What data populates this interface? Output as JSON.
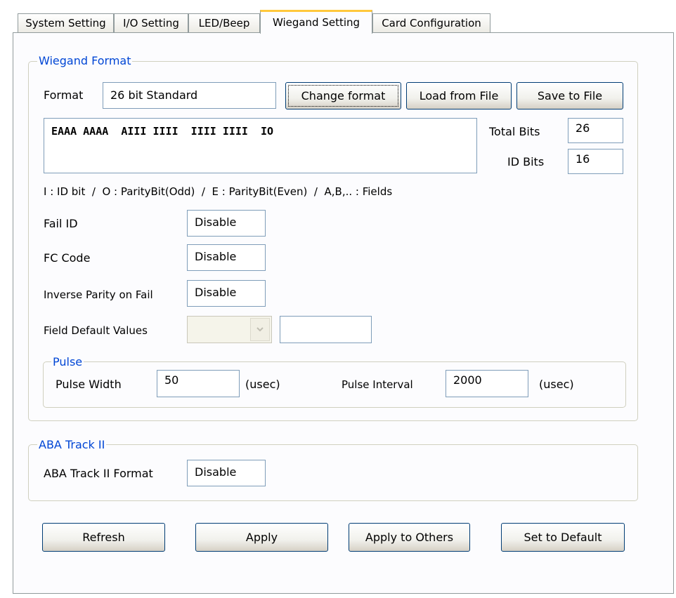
{
  "tabs": [
    {
      "label": "System Setting"
    },
    {
      "label": "I/O Setting"
    },
    {
      "label": "LED/Beep"
    },
    {
      "label": "Wiegand Setting"
    },
    {
      "label": "Card Configuration"
    }
  ],
  "wiegand": {
    "legend": "Wiegand Format",
    "format_label": "Format",
    "format_value": "26 bit Standard",
    "change_format": "Change format",
    "load_file": "Load from File",
    "save_file": "Save to File",
    "bit_pattern": "EAAA AAAA  AIII IIII  IIII IIII  IO",
    "total_bits_label": "Total Bits",
    "total_bits": "26",
    "id_bits_label": "ID Bits",
    "id_bits": "16",
    "legend_help": "I : ID bit  /  O : ParityBit(Odd)  /  E : ParityBit(Even)  /  A,B,.. : Fields",
    "fail_id_label": "Fail ID",
    "fail_id": "Disable",
    "fc_code_label": "FC Code",
    "fc_code": "Disable",
    "inverse_parity_label": "Inverse Parity on Fail",
    "inverse_parity": "Disable",
    "field_default_label": "Field Default Values",
    "field_default_select": "",
    "field_default_value": ""
  },
  "pulse": {
    "legend": "Pulse",
    "width_label": "Pulse Width",
    "width": "50",
    "width_unit": "(usec)",
    "interval_label": "Pulse Interval",
    "interval": "2000",
    "interval_unit": "(usec)"
  },
  "aba": {
    "legend": "ABA Track II",
    "format_label": "ABA Track II Format",
    "format_value": "Disable"
  },
  "buttons": {
    "refresh": "Refresh",
    "apply": "Apply",
    "apply_others": "Apply to Others",
    "set_default": "Set to Default"
  },
  "icons": {
    "dropdown": "chevron-down-icon"
  }
}
